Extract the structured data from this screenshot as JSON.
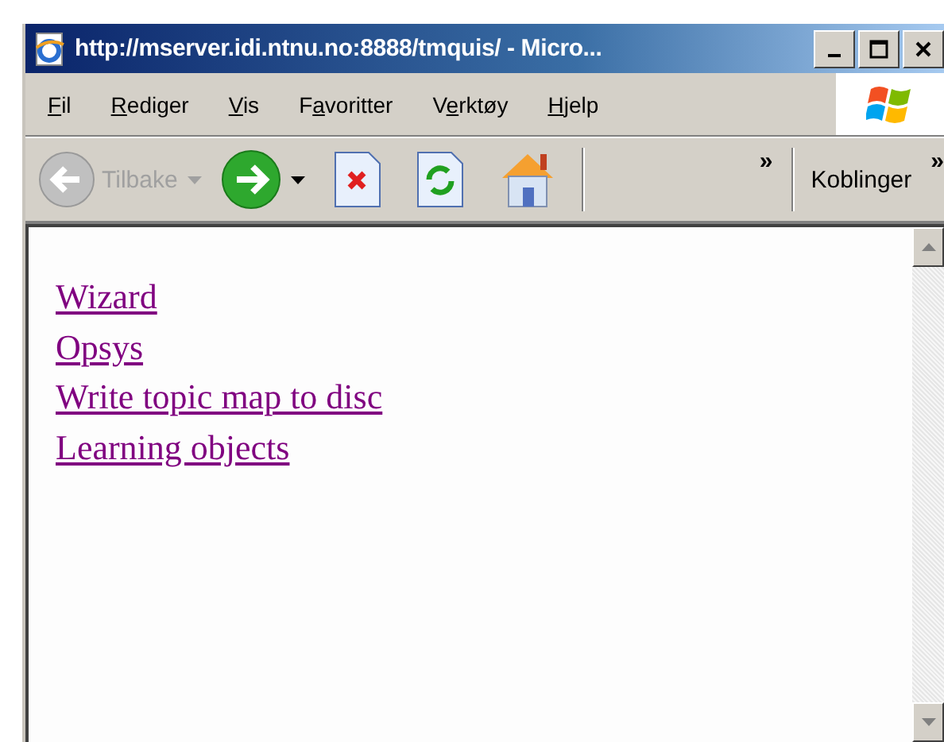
{
  "window": {
    "title": "http://mserver.idi.ntnu.no:8888/tmquis/ - Micro..."
  },
  "menu": [
    {
      "label": "Fil"
    },
    {
      "label": "Rediger"
    },
    {
      "label": "Vis"
    },
    {
      "label": "Favoritter"
    },
    {
      "label": "Verktøy"
    },
    {
      "label": "Hjelp"
    }
  ],
  "toolbar": {
    "back": {
      "label": "Tilbake",
      "disabled": true
    },
    "more": "»",
    "links_label": "Koblinger",
    "links_more": "»"
  },
  "links": [
    "Wizard",
    "Opsys",
    "Write topic map to disc",
    "Learning objects"
  ]
}
